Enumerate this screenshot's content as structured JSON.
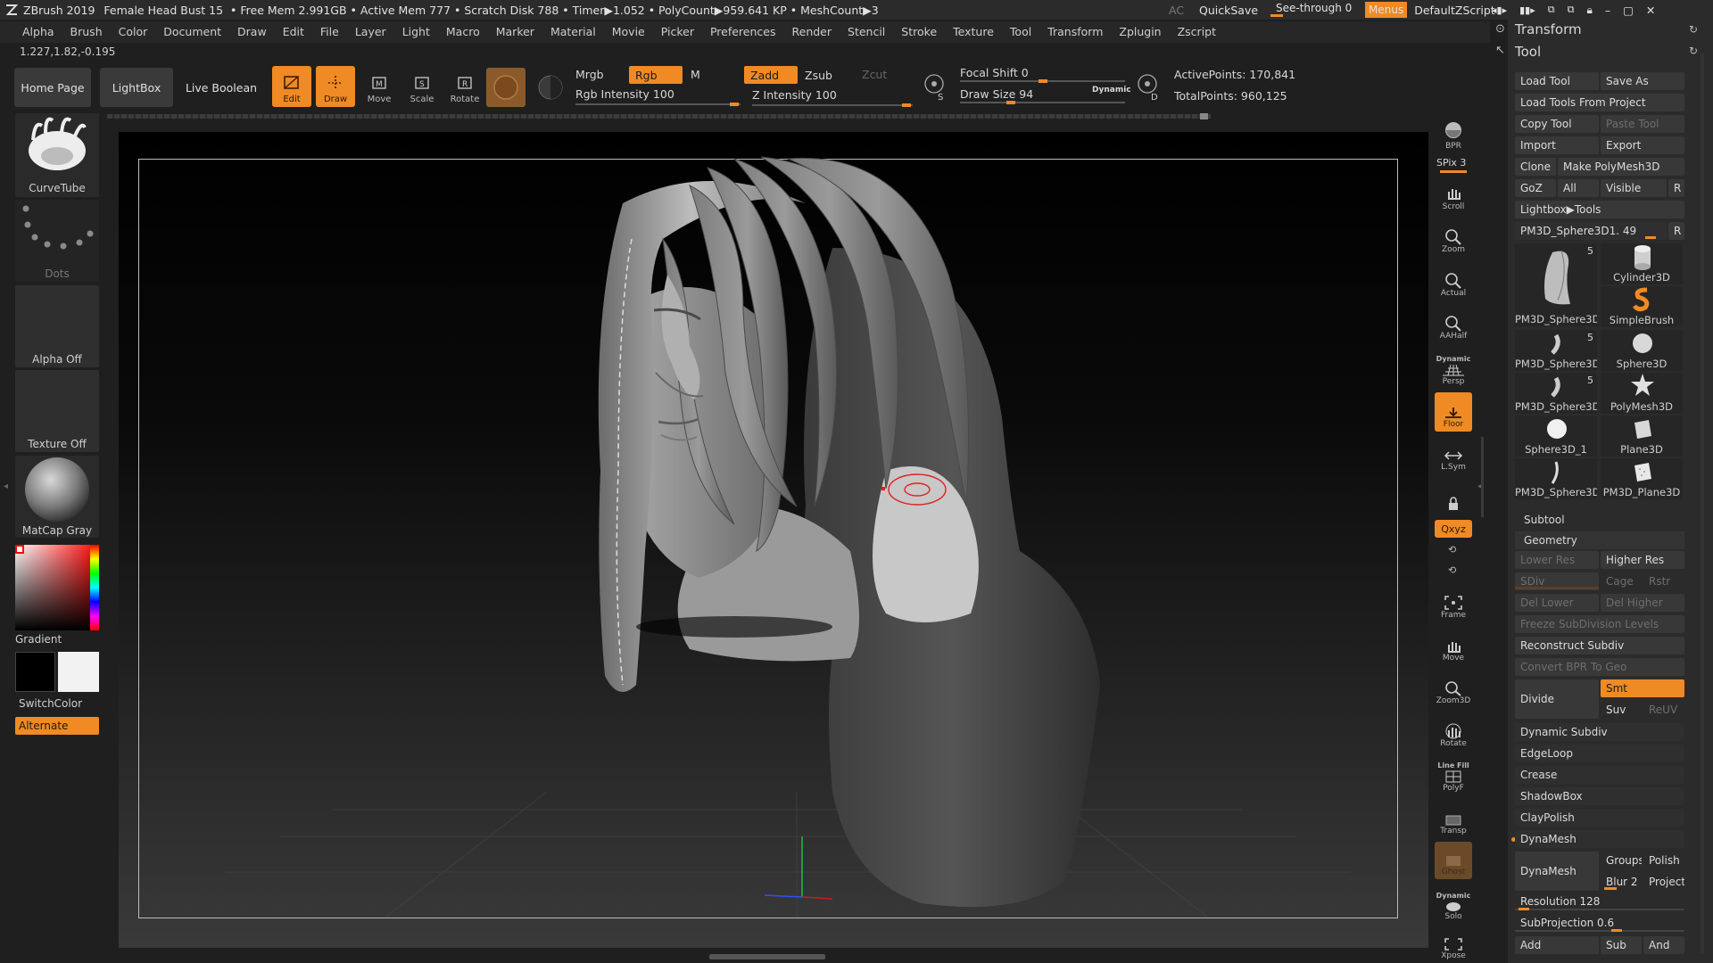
{
  "titlebar": {
    "app": "ZBrush 2019",
    "doc": "Female Head Bust 15",
    "stats": "• Free Mem 2.991GB • Active Mem 777 • Scratch Disk 788 • Timer▶1.052 • PolyCount▶959.641 KP • MeshCount▶3",
    "ac": "AC",
    "quicksave": "QuickSave",
    "seethrough": "See-through  0",
    "menus": "Menus",
    "zscript": "DefaultZScript"
  },
  "menu": [
    "Alpha",
    "Brush",
    "Color",
    "Document",
    "Draw",
    "Edit",
    "File",
    "Layer",
    "Light",
    "Macro",
    "Marker",
    "Material",
    "Movie",
    "Picker",
    "Preferences",
    "Render",
    "Stencil",
    "Stroke",
    "Texture",
    "Tool",
    "Transform",
    "Zplugin",
    "Zscript"
  ],
  "coords": "1.227,1.82,-0.195",
  "shelf": {
    "home": "Home Page",
    "lightbox": "LightBox",
    "liveboolean": "Live Boolean",
    "edit": "Edit",
    "draw": "Draw",
    "move": "Move",
    "scale": "Scale",
    "rotate": "Rotate",
    "mrgb": "Mrgb",
    "rgb": "Rgb",
    "m": "M",
    "zadd": "Zadd",
    "zsub": "Zsub",
    "zcut": "Zcut",
    "rgb_intensity": "Rgb Intensity 100",
    "z_intensity": "Z Intensity 100",
    "focal_shift": "Focal Shift 0",
    "draw_size": "Draw Size 94",
    "dynamic": "Dynamic",
    "active_points": "ActivePoints: 170,841",
    "total_points": "TotalPoints: 960,125",
    "s": "S",
    "d": "D"
  },
  "lefttray": {
    "brush": "CurveTube",
    "stroke": "Dots",
    "alpha": "Alpha Off",
    "texture": "Texture Off",
    "material": "MatCap Gray",
    "gradient": "Gradient",
    "switchcolor": "SwitchColor",
    "alternate": "Alternate"
  },
  "righttray": {
    "bpr": "BPR",
    "spix": "SPix 3",
    "scroll": "Scroll",
    "zoom": "Zoom",
    "actual": "Actual",
    "aahalf": "AAHalf",
    "dynamic": "Dynamic",
    "persp": "Persp",
    "floor": "Floor",
    "lsym": "L.Sym",
    "xyz": "Qxyz",
    "frame": "Frame",
    "move": "Move",
    "zoom3d": "Zoom3D",
    "rotate": "Rotate",
    "linefill": "Line Fill",
    "polyf": "PolyF",
    "transp": "Transp",
    "ghost": "Ghost",
    "dynamic2": "Dynamic",
    "solo": "Solo",
    "xpose": "Xpose"
  },
  "panel": {
    "transform": "Transform",
    "tool": "Tool",
    "load_tool": "Load Tool",
    "save_as": "Save As",
    "load_from_project": "Load Tools From Project",
    "copy_tool": "Copy Tool",
    "paste_tool": "Paste Tool",
    "import": "Import",
    "export": "Export",
    "clone": "Clone",
    "make_polymesh": "Make PolyMesh3D",
    "goz": "GoZ",
    "all": "All",
    "visible": "Visible",
    "r": "R",
    "lightbox_tools": "Lightbox▶Tools",
    "current_tool": "PM3D_Sphere3D1. 49",
    "thumbs": [
      {
        "label": "PM3D_Sphere3D",
        "num": "5"
      },
      {
        "label": "Cylinder3D",
        "num": ""
      },
      {
        "label": "SimpleBrush",
        "num": ""
      },
      {
        "label": "PM3D_Sphere3D",
        "num": "5"
      },
      {
        "label": "Sphere3D",
        "num": ""
      },
      {
        "label": "PM3D_Sphere3D",
        "num": "5"
      },
      {
        "label": "PolyMesh3D",
        "num": ""
      },
      {
        "label": "Sphere3D_1",
        "num": ""
      },
      {
        "label": "Plane3D",
        "num": ""
      },
      {
        "label": "PM3D_Sphere3D",
        "num": ""
      },
      {
        "label": "PM3D_Plane3D",
        "num": ""
      }
    ],
    "subtool": "Subtool",
    "geometry": "Geometry",
    "lower_res": "Lower Res",
    "higher_res": "Higher Res",
    "sdiv": "SDiv",
    "cage": "Cage",
    "rstr": "Rstr",
    "del_lower": "Del Lower",
    "del_higher": "Del Higher",
    "freeze": "Freeze SubDivision Levels",
    "reconstruct": "Reconstruct Subdiv",
    "convert_bpr": "Convert BPR To Geo",
    "divide": "Divide",
    "smt": "Smt",
    "suv": "Suv",
    "reuv": "ReUV",
    "dynamic_subdiv": "Dynamic Subdiv",
    "edgeloop": "EdgeLoop",
    "crease": "Crease",
    "shadowbox": "ShadowBox",
    "claypolish": "ClayPolish",
    "dynamesh_header": "DynaMesh",
    "dynamesh": "DynaMesh",
    "groups": "Groups",
    "polish": "Polish",
    "blur": "Blur 2",
    "project": "Project",
    "resolution": "Resolution 128",
    "subprojection": "SubProjection 0.6",
    "add": "Add",
    "sub": "Sub",
    "and": "And"
  },
  "colors": {
    "accent": "#f08a24",
    "bg": "#1f1f1f",
    "panel": "#2b2b2b"
  }
}
